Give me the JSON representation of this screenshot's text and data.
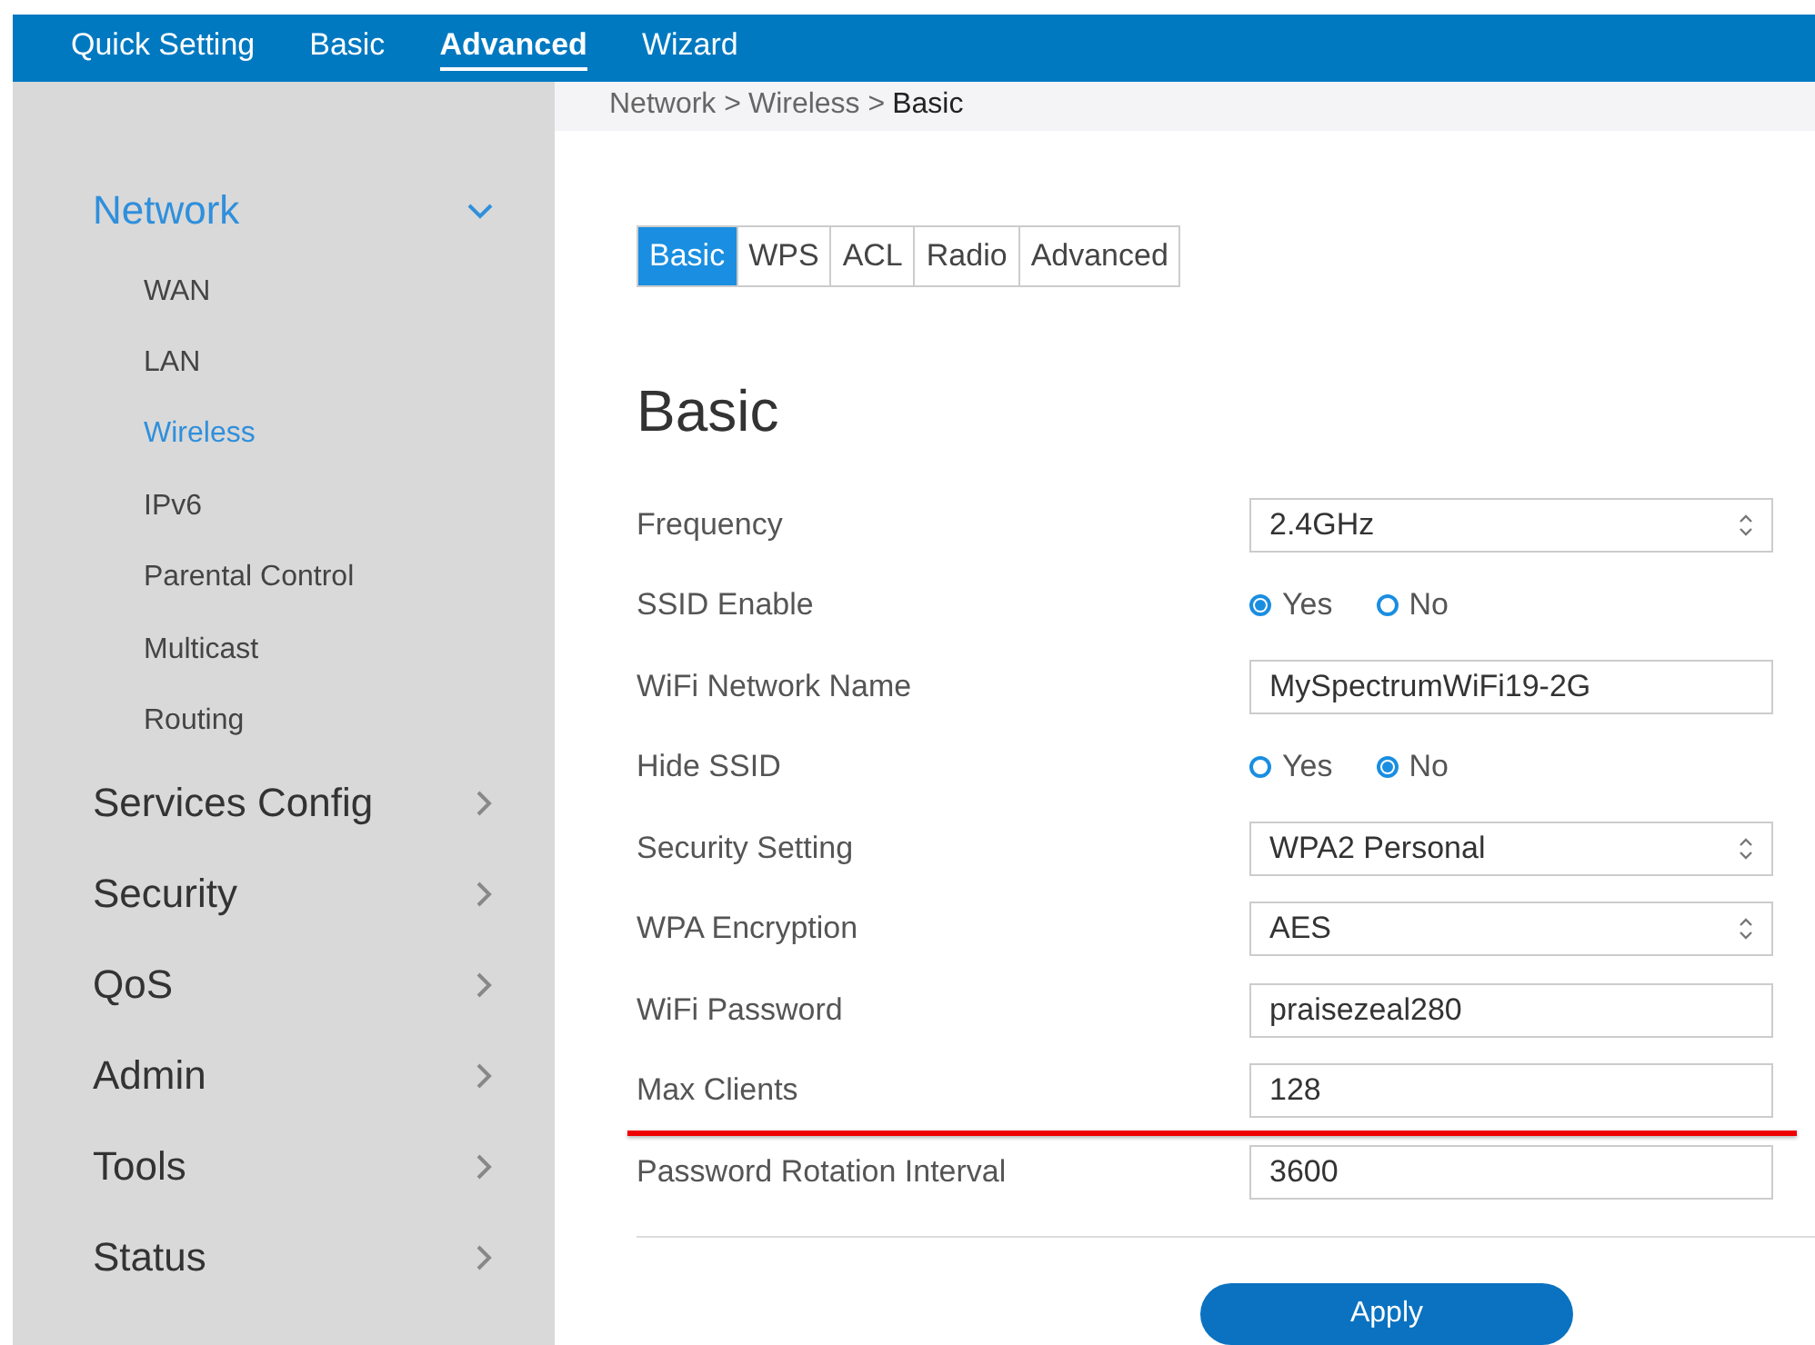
{
  "top_nav": [
    {
      "label": "Quick Setting",
      "selected": false
    },
    {
      "label": "Basic",
      "selected": false
    },
    {
      "label": "Advanced",
      "selected": true
    },
    {
      "label": "Wizard",
      "selected": false
    }
  ],
  "sidebar": {
    "items": [
      {
        "label": "Network",
        "expanded": true,
        "children": [
          {
            "label": "WAN",
            "selected": false
          },
          {
            "label": "LAN",
            "selected": false
          },
          {
            "label": "Wireless",
            "selected": true
          },
          {
            "label": "IPv6",
            "selected": false
          },
          {
            "label": "Parental Control",
            "selected": false
          },
          {
            "label": "Multicast",
            "selected": false
          },
          {
            "label": "Routing",
            "selected": false
          }
        ]
      },
      {
        "label": "Services Config",
        "expanded": false
      },
      {
        "label": "Security",
        "expanded": false
      },
      {
        "label": "QoS",
        "expanded": false
      },
      {
        "label": "Admin",
        "expanded": false
      },
      {
        "label": "Tools",
        "expanded": false
      },
      {
        "label": "Status",
        "expanded": false
      }
    ]
  },
  "breadcrumb": {
    "path": [
      "Network >",
      "Wireless >"
    ],
    "current": "Basic"
  },
  "tabs": [
    {
      "label": "Basic",
      "selected": true
    },
    {
      "label": "WPS",
      "selected": false
    },
    {
      "label": "ACL",
      "selected": false
    },
    {
      "label": "Radio",
      "selected": false
    },
    {
      "label": "Advanced",
      "selected": false
    }
  ],
  "heading": "Basic",
  "fields": [
    {
      "kind": "select",
      "label": "Frequency",
      "value": "2.4GHz"
    },
    {
      "kind": "radio",
      "label": "SSID Enable",
      "options": [
        {
          "label": "Yes",
          "selected": true
        },
        {
          "label": "No",
          "selected": false
        }
      ]
    },
    {
      "kind": "text",
      "label": "WiFi Network Name",
      "value": "MySpectrumWiFi19-2G"
    },
    {
      "kind": "radio",
      "label": "Hide SSID",
      "options": [
        {
          "label": "Yes",
          "selected": false
        },
        {
          "label": "No",
          "selected": true
        }
      ]
    },
    {
      "kind": "select",
      "label": "Security Setting",
      "value": "WPA2 Personal"
    },
    {
      "kind": "select",
      "label": "WPA Encryption",
      "value": "AES"
    },
    {
      "kind": "text",
      "label": "WiFi Password",
      "value": "praisezeal280"
    },
    {
      "kind": "text",
      "label": "Max Clients",
      "value": "128",
      "underlined": true
    },
    {
      "kind": "text",
      "label": "Password Rotation Interval",
      "value": "3600"
    }
  ],
  "apply_button": "Apply"
}
